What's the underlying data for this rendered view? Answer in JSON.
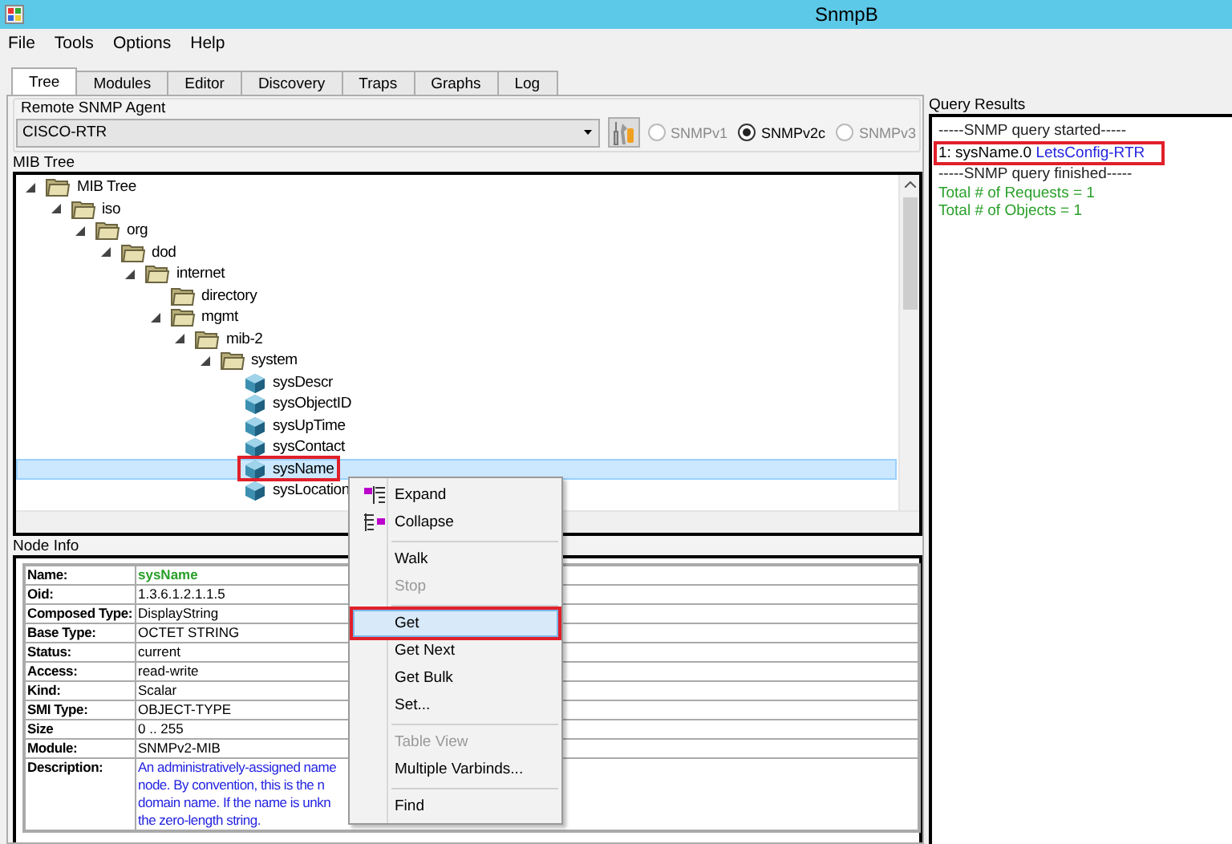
{
  "window": {
    "title": "SnmpB"
  },
  "menu": [
    "File",
    "Tools",
    "Options",
    "Help"
  ],
  "tabs": [
    {
      "label": "Tree",
      "selected": true
    },
    {
      "label": "Modules",
      "selected": false
    },
    {
      "label": "Editor",
      "selected": false
    },
    {
      "label": "Discovery",
      "selected": false
    },
    {
      "label": "Traps",
      "selected": false
    },
    {
      "label": "Graphs",
      "selected": false
    },
    {
      "label": "Log",
      "selected": false
    }
  ],
  "agent": {
    "label": "Remote SNMP Agent",
    "value": "CISCO-RTR",
    "versions": [
      {
        "label": "SNMPv1",
        "selected": false,
        "disabled": true
      },
      {
        "label": "SNMPv2c",
        "selected": true,
        "disabled": false
      },
      {
        "label": "SNMPv3",
        "selected": false,
        "disabled": true
      }
    ]
  },
  "mib_tree": {
    "label": "MIB Tree",
    "items": [
      {
        "label": "MIB Tree",
        "kind": "folder",
        "expanded": true,
        "selected": false,
        "annotated": false,
        "children": [
          {
            "label": "iso",
            "kind": "folder",
            "expanded": true,
            "selected": false,
            "annotated": false,
            "children": [
              {
                "label": "org",
                "kind": "folder",
                "expanded": true,
                "selected": false,
                "annotated": false,
                "children": [
                  {
                    "label": "dod",
                    "kind": "folder",
                    "expanded": true,
                    "selected": false,
                    "annotated": false,
                    "children": [
                      {
                        "label": "internet",
                        "kind": "folder",
                        "expanded": true,
                        "selected": false,
                        "annotated": false,
                        "children": [
                          {
                            "label": "directory",
                            "kind": "folder",
                            "selected": false,
                            "annotated": false
                          },
                          {
                            "label": "mgmt",
                            "kind": "folder",
                            "expanded": true,
                            "selected": false,
                            "annotated": false,
                            "children": [
                              {
                                "label": "mib-2",
                                "kind": "folder",
                                "expanded": true,
                                "selected": false,
                                "annotated": false,
                                "children": [
                                  {
                                    "label": "system",
                                    "kind": "folder",
                                    "expanded": true,
                                    "selected": false,
                                    "annotated": false,
                                    "children": [
                                      {
                                        "label": "sysDescr",
                                        "kind": "leaf",
                                        "selected": false,
                                        "annotated": false
                                      },
                                      {
                                        "label": "sysObjectID",
                                        "kind": "leaf",
                                        "selected": false,
                                        "annotated": false
                                      },
                                      {
                                        "label": "sysUpTime",
                                        "kind": "leaf",
                                        "selected": false,
                                        "annotated": false
                                      },
                                      {
                                        "label": "sysContact",
                                        "kind": "leaf",
                                        "selected": false,
                                        "annotated": false
                                      },
                                      {
                                        "label": "sysName",
                                        "kind": "leaf",
                                        "selected": true,
                                        "annotated": true
                                      },
                                      {
                                        "label": "sysLocation",
                                        "kind": "leaf",
                                        "selected": false,
                                        "annotated": false
                                      }
                                    ]
                                  }
                                ]
                              }
                            ]
                          }
                        ]
                      }
                    ]
                  }
                ]
              }
            ]
          }
        ]
      }
    ]
  },
  "node_info": {
    "label": "Node Info",
    "rows": [
      {
        "label": "Name:",
        "value": "sysName",
        "kind": "name"
      },
      {
        "label": "Oid:",
        "value": "1.3.6.1.2.1.1.5",
        "kind": "plain"
      },
      {
        "label": "Composed Type:",
        "value": "DisplayString",
        "kind": "plain"
      },
      {
        "label": "Base Type:",
        "value": "OCTET STRING",
        "kind": "plain"
      },
      {
        "label": "Status:",
        "value": "current",
        "kind": "plain"
      },
      {
        "label": "Access:",
        "value": "read-write",
        "kind": "plain"
      },
      {
        "label": "Kind:",
        "value": "Scalar",
        "kind": "plain"
      },
      {
        "label": "SMI Type:",
        "value": "OBJECT-TYPE",
        "kind": "plain"
      },
      {
        "label": "Size",
        "value": "0 .. 255",
        "kind": "plain"
      },
      {
        "label": "Module:",
        "value": "SNMPv2-MIB",
        "kind": "plain"
      },
      {
        "label": "Description:",
        "lines": [
          "An administratively-assigned name",
          "node.  By convention, this is the n",
          "domain name.  If the name is unkn",
          "the zero-length string."
        ],
        "kind": "description"
      }
    ]
  },
  "context_menu": [
    {
      "kind": "item",
      "label": "Expand",
      "disabled": false,
      "selected": false,
      "annotated": false
    },
    {
      "kind": "item",
      "label": "Collapse",
      "disabled": false,
      "selected": false,
      "annotated": false
    },
    {
      "kind": "separator"
    },
    {
      "kind": "item",
      "label": "Walk",
      "disabled": false,
      "selected": false,
      "annotated": false
    },
    {
      "kind": "item",
      "label": "Stop",
      "disabled": true,
      "selected": false,
      "annotated": false
    },
    {
      "kind": "separator"
    },
    {
      "kind": "item",
      "label": "Get",
      "disabled": false,
      "selected": true,
      "annotated": true
    },
    {
      "kind": "item",
      "label": "Get Next",
      "disabled": false,
      "selected": false,
      "annotated": false
    },
    {
      "kind": "item",
      "label": "Get Bulk",
      "disabled": false,
      "selected": false,
      "annotated": false
    },
    {
      "kind": "item",
      "label": "Set...",
      "disabled": false,
      "selected": false,
      "annotated": false
    },
    {
      "kind": "separator"
    },
    {
      "kind": "item",
      "label": "Table View",
      "disabled": true,
      "selected": false,
      "annotated": false
    },
    {
      "kind": "item",
      "label": "Multiple Varbinds...",
      "disabled": false,
      "selected": false,
      "annotated": false
    },
    {
      "kind": "separator"
    },
    {
      "kind": "item",
      "label": "Find",
      "disabled": false,
      "selected": false,
      "annotated": false
    }
  ],
  "query_results": {
    "label": "Query Results",
    "lines": [
      {
        "kind": "status",
        "text": "-----SNMP query started-----"
      },
      {
        "kind": "result",
        "oid": "1: sysName.0",
        "value": "LetsConfig-RTR",
        "annotated": true
      },
      {
        "kind": "status",
        "text": "-----SNMP query finished-----"
      },
      {
        "kind": "summary",
        "text": "Total # of Requests = 1"
      },
      {
        "kind": "summary",
        "text": "Total # of Objects = 1"
      }
    ]
  }
}
